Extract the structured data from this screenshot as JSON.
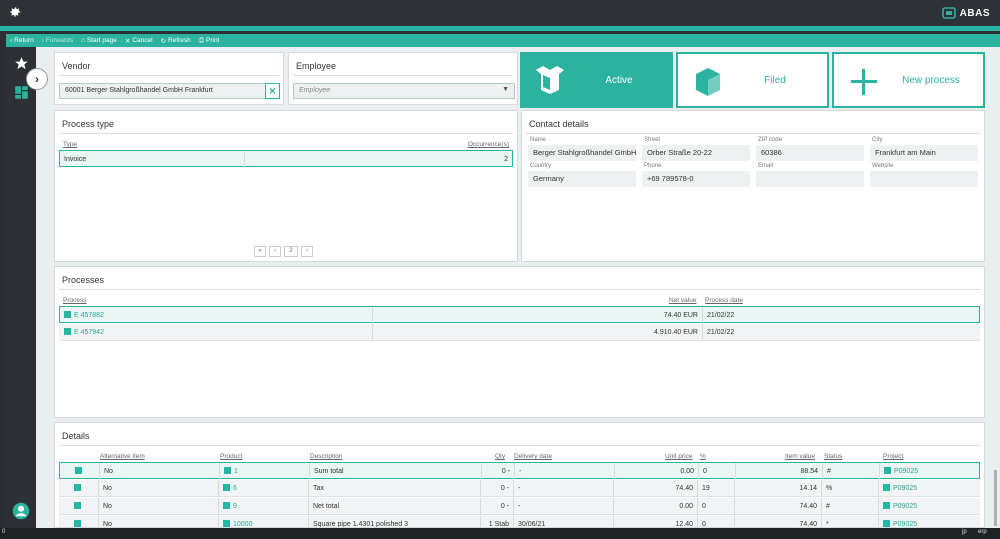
{
  "brand": {
    "name": "ABAS"
  },
  "toolbar": {
    "return": "Return",
    "forwards": "Forwards",
    "start_page": "Start page",
    "cancel": "Cancel",
    "refresh": "Refresh",
    "print": "Print"
  },
  "vendor": {
    "title": "Vendor",
    "value": "60001  Berger Stahlgroßhandel GmbH Frankfurt",
    "clear": "✕"
  },
  "employee": {
    "title": "Employee",
    "placeholder": "Employee"
  },
  "actions": {
    "active": "Active",
    "filed": "Filed",
    "new_process": "New process"
  },
  "process_type": {
    "title": "Process type",
    "col_type": "Type",
    "col_occ": "Occurrence(s)",
    "rows": [
      {
        "type": "Invoice",
        "occurrences": "2"
      }
    ],
    "pager": {
      "first": "«",
      "prev": "‹",
      "page": "2",
      "next": "›"
    }
  },
  "contact": {
    "title": "Contact details",
    "name_label": "Name",
    "name": "Berger Stahlgroßhandel GmbH",
    "street_label": "Street",
    "street": "Orber Straße 20-22",
    "zip_label": "ZIP code",
    "zip": "60386",
    "city_label": "City",
    "city": "Frankfurt am Main",
    "country_label": "Country",
    "country": "Germany",
    "phone_label": "Phone",
    "phone": "+69 789578-0",
    "email_label": "Email",
    "email": "",
    "website_label": "Website",
    "website": ""
  },
  "processes": {
    "title": "Processes",
    "col_process": "Process",
    "col_net": "Net value",
    "col_date": "Process date",
    "rows": [
      {
        "process": "E 457882",
        "net": "74.40 EUR",
        "date": "21/02/22"
      },
      {
        "process": "E 457942",
        "net": "4.910.40 EUR",
        "date": "21/02/22"
      }
    ]
  },
  "details": {
    "title": "Details",
    "headers": {
      "alt": "Alternative item",
      "product": "Product",
      "desc": "Description",
      "qty": "Qty",
      "delivery": "Delivery date",
      "unit_price": "Unit price",
      "pct": "%",
      "item_value": "Item value",
      "status": "Status",
      "project": "Project"
    },
    "rows": [
      {
        "alt": "No",
        "product": "1",
        "desc": "Sum total",
        "qty": "0 -",
        "delivery": "-",
        "unit_price": "0.00",
        "pct": "0",
        "item_value": "88.54",
        "status": "#",
        "project": "P09025"
      },
      {
        "alt": "No",
        "product": "6",
        "desc": "Tax",
        "qty": "0 -",
        "delivery": "-",
        "unit_price": "74.40",
        "pct": "19",
        "item_value": "14.14",
        "status": "%",
        "project": "P09025"
      },
      {
        "alt": "No",
        "product": "9",
        "desc": "Net total",
        "qty": "0 -",
        "delivery": "-",
        "unit_price": "0.00",
        "pct": "0",
        "item_value": "74.40",
        "status": "#",
        "project": "P09025"
      },
      {
        "alt": "No",
        "product": "10000",
        "desc": "Square pipe 1.4301 polished 3",
        "qty": "1 Stab",
        "delivery": "30/06/21",
        "unit_price": "12.40",
        "pct": "0",
        "item_value": "74.40",
        "status": "*",
        "project": "P09025"
      }
    ]
  },
  "footer": {
    "left": "0",
    "lang": "jp",
    "mode": "erp"
  },
  "colors": {
    "accent": "#2bb3a0",
    "dark": "#2e3236"
  }
}
